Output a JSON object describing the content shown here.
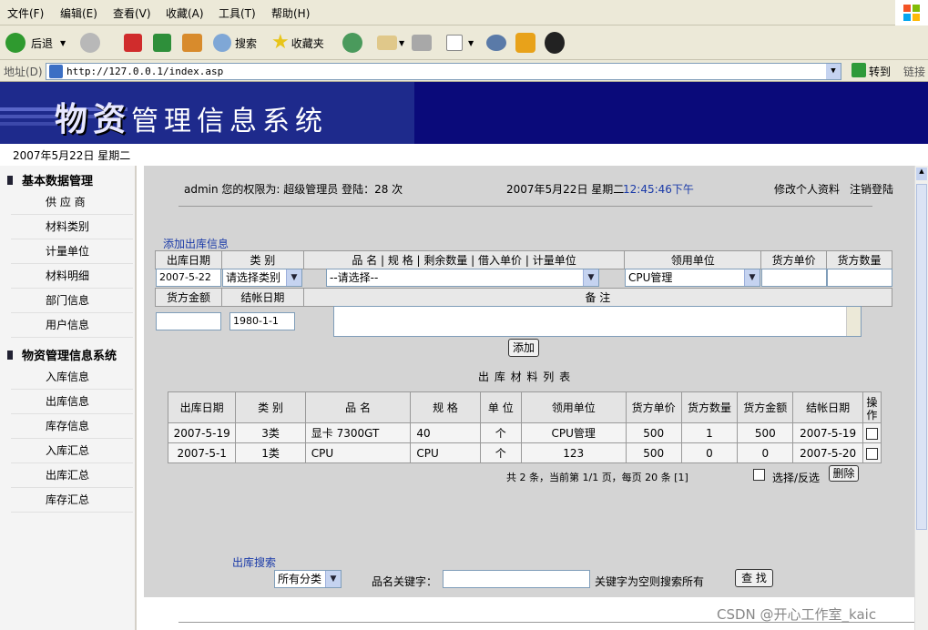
{
  "menu": [
    "文件(F)",
    "编辑(E)",
    "查看(V)",
    "收藏(A)",
    "工具(T)",
    "帮助(H)"
  ],
  "toolbar": {
    "back": "后退",
    "search": "搜索",
    "favorites": "收藏夹"
  },
  "address": {
    "label": "地址(D)",
    "url": "http://127.0.0.1/index.asp",
    "go": "转到",
    "links": "链接"
  },
  "banner": {
    "title_big": "物资",
    "title_rest": "管理信息系统"
  },
  "date_line": "2007年5月22日 星期二",
  "sidebar": {
    "group1": "基本数据管理",
    "group1_items": [
      "供 应 商",
      "材料类别",
      "计量单位",
      "材料明细",
      "部门信息",
      "用户信息"
    ],
    "group2": "物资管理信息系统",
    "group2_items": [
      "入库信息",
      "出库信息",
      "库存信息",
      "入库汇总",
      "出库汇总",
      "库存汇总"
    ]
  },
  "topinfo": {
    "user": "admin 您的权限为: 超级管理员 登陆：28 次",
    "date": "2007年5月22日 星期二",
    "time": "12:45:46下午",
    "edit_profile": "修改个人资料",
    "logout": "注销登陆"
  },
  "add_form": {
    "title": "添加出库信息",
    "headers1": [
      "出库日期",
      "类 别",
      "品 名 | 规 格 | 剩余数量 | 借入单价 | 计量单位",
      "领用单位",
      "货方单价",
      "货方数量"
    ],
    "date_value": "2007-5-22",
    "category_value": "请选择类别",
    "item_value": "--请选择--",
    "dept_value": "CPU管理",
    "headers2": [
      "货方金额",
      "结帐日期",
      "备 注"
    ],
    "settle_date": "1980-1-1",
    "add_button": "添加"
  },
  "list": {
    "title": "出 库 材 料 列 表",
    "headers": [
      "出库日期",
      "类 别",
      "品 名",
      "规 格",
      "单 位",
      "领用单位",
      "货方单价",
      "货方数量",
      "货方金额",
      "结帐日期",
      "操作"
    ],
    "rows": [
      [
        "2007-5-19",
        "3类",
        "显卡 7300GT",
        "40",
        "个",
        "CPU管理",
        "500",
        "1",
        "500",
        "2007-5-19"
      ],
      [
        "2007-5-1",
        "1类",
        "CPU",
        "CPU",
        "个",
        "123",
        "500",
        "0",
        "0",
        "2007-5-20"
      ]
    ],
    "pager": "共 2 条，当前第 1/1 页，每页 20 条 [1]",
    "select_all": "选择/反选",
    "delete": "删除"
  },
  "search": {
    "title": "出库搜索",
    "category": "所有分类",
    "keyword_label": "品名关键字：",
    "hint": "关键字为空则搜索所有",
    "button": "查 找"
  },
  "watermark": "CSDN @开心工作室_kaic"
}
